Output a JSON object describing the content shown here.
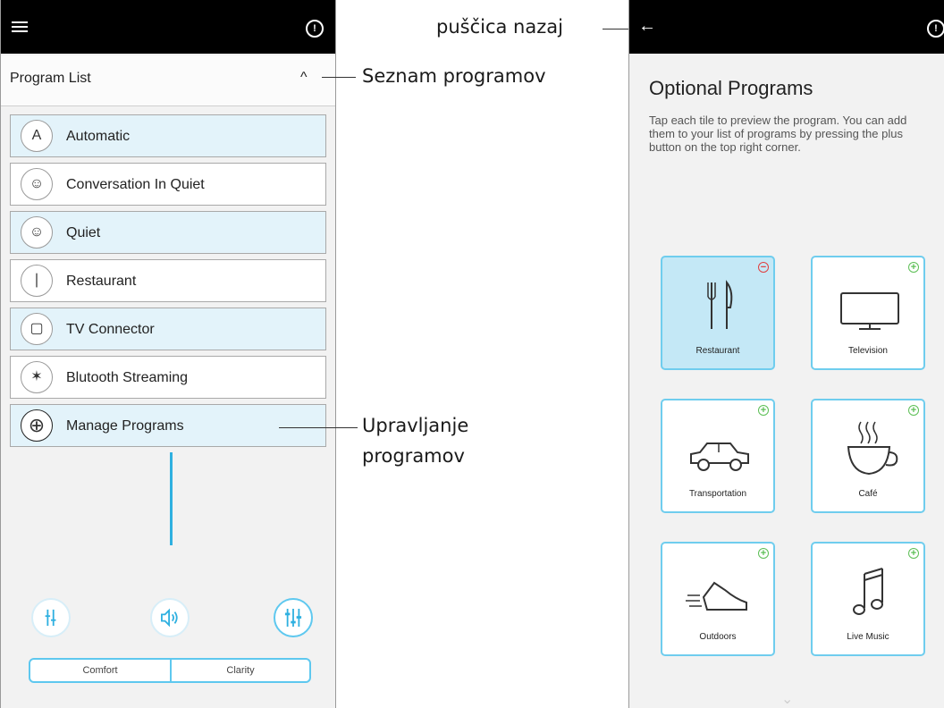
{
  "left_screen": {
    "program_list": {
      "title": "Program List",
      "collapse_glyph": "^",
      "items": [
        {
          "label": "Automatic",
          "icon": "automatic-icon",
          "glyph": "A"
        },
        {
          "label": "Conversation In Quiet",
          "icon": "conversation-icon",
          "glyph": "☺"
        },
        {
          "label": "Quiet",
          "icon": "quiet-icon",
          "glyph": "☺"
        },
        {
          "label": "Restaurant",
          "icon": "cutlery-icon",
          "glyph": "∣"
        },
        {
          "label": "TV Connector",
          "icon": "tv-connector-icon",
          "glyph": "▢"
        },
        {
          "label": "Blutooth Streaming",
          "icon": "bluetooth-icon",
          "glyph": "✶"
        },
        {
          "label": "Manage Programs",
          "icon": "plus-circle-icon",
          "glyph": "⊕"
        }
      ]
    },
    "controls": {
      "segment_left": "Comfort",
      "segment_right": "Clarity"
    }
  },
  "right_screen": {
    "title": "Optional Programs",
    "description": "Tap each tile to preview the program. You can add them to your list of programs by pressing the plus button on the top right corner.",
    "tiles": [
      {
        "label": "Restaurant",
        "icon": "cutlery-icon",
        "badge": "−",
        "selected": true
      },
      {
        "label": "Television",
        "icon": "television-icon",
        "badge": "+",
        "selected": false
      },
      {
        "label": "Transportation",
        "icon": "car-icon",
        "badge": "+",
        "selected": false
      },
      {
        "label": "Café",
        "icon": "coffee-cup-icon",
        "badge": "+",
        "selected": false
      },
      {
        "label": "Outdoors",
        "icon": "shoe-icon",
        "badge": "+",
        "selected": false
      },
      {
        "label": "Live Music",
        "icon": "music-note-icon",
        "badge": "+",
        "selected": false
      }
    ]
  },
  "annotations": {
    "program_list": "Seznam programov",
    "manage_programs_line1": "Upravljanje",
    "manage_programs_line2": "programov",
    "back_arrow": "puščica nazaj"
  },
  "colors": {
    "accent": "#2fb0e0",
    "row_highlight": "#e3f3fa",
    "tile_border": "#6fcdee",
    "selected_tile": "#c4e8f6",
    "add_badge": "#5cbf55",
    "remove_badge": "#e04040"
  }
}
